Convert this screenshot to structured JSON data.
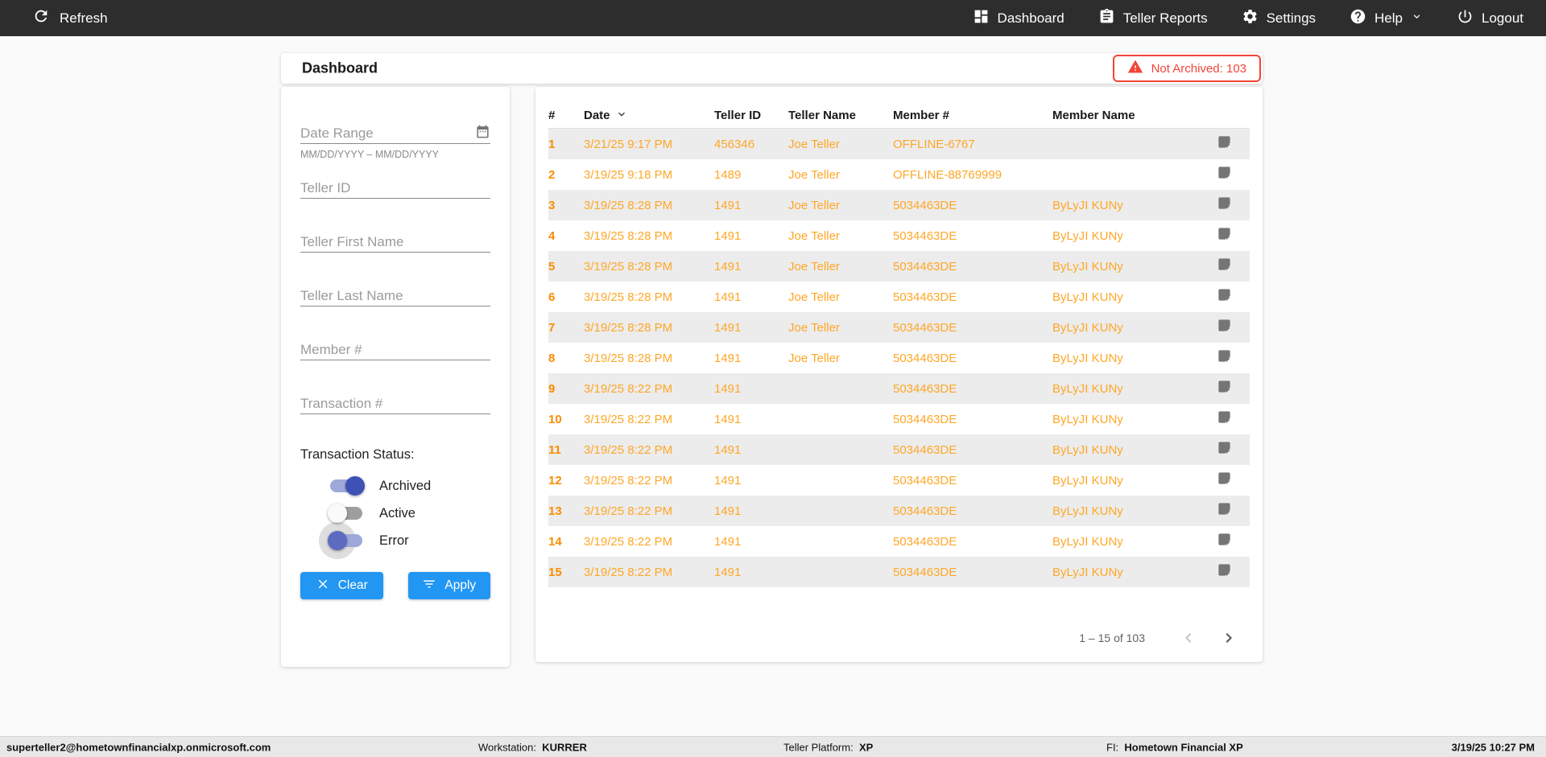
{
  "colors": {
    "topbar_bg": "#2d2d2d",
    "accent_blue": "#2196f3",
    "row_orange": "#ffa726",
    "index_orange": "#fb8c00",
    "alert_red": "#f44336",
    "toggle_indigo": "#3f51b5",
    "toggle_track_indigo": "#9fa8da"
  },
  "topbar": {
    "refresh_label": "Refresh",
    "nav_items": [
      {
        "id": "dashboard",
        "label": "Dashboard",
        "icon": "dashboard-icon"
      },
      {
        "id": "teller-reports",
        "label": "Teller Reports",
        "icon": "clipboard-icon"
      },
      {
        "id": "settings",
        "label": "Settings",
        "icon": "gear-icon"
      },
      {
        "id": "help",
        "label": "Help",
        "icon": "help-icon",
        "has_chevron": true
      },
      {
        "id": "logout",
        "label": "Logout",
        "icon": "power-icon"
      }
    ]
  },
  "header": {
    "title": "Dashboard",
    "alert_badge": "Not Archived: 103"
  },
  "filters": {
    "fields": [
      {
        "id": "date-range",
        "placeholder": "Date Range",
        "hint": "MM/DD/YYYY – MM/DD/YYYY",
        "icon": "calendar-icon"
      },
      {
        "id": "teller-id",
        "placeholder": "Teller ID"
      },
      {
        "id": "teller-first-name",
        "placeholder": "Teller First Name"
      },
      {
        "id": "teller-last-name",
        "placeholder": "Teller Last Name"
      },
      {
        "id": "member-number",
        "placeholder": "Member #"
      },
      {
        "id": "transaction-number",
        "placeholder": "Transaction #"
      }
    ],
    "status_label": "Transaction Status:",
    "toggles": [
      {
        "id": "archived",
        "label": "Archived",
        "state": "on"
      },
      {
        "id": "active",
        "label": "Active",
        "state": "off"
      },
      {
        "id": "error",
        "label": "Error",
        "state": "focus"
      }
    ],
    "clear_label": "Clear",
    "apply_label": "Apply"
  },
  "table": {
    "columns": [
      "#",
      "Date",
      "Teller ID",
      "Teller Name",
      "Member #",
      "Member Name"
    ],
    "sort_column": "Date",
    "rows": [
      {
        "num": "1",
        "date": "3/21/25 9:17 PM",
        "teller_id": "456346",
        "teller_name": "Joe Teller",
        "member_number": "OFFLINE-6767",
        "member_name": ""
      },
      {
        "num": "2",
        "date": "3/19/25 9:18 PM",
        "teller_id": "1489",
        "teller_name": "Joe Teller",
        "member_number": "OFFLINE-88769999",
        "member_name": ""
      },
      {
        "num": "3",
        "date": "3/19/25 8:28 PM",
        "teller_id": "1491",
        "teller_name": "Joe Teller",
        "member_number": "5034463DE",
        "member_name": "ByLyJI KUNy"
      },
      {
        "num": "4",
        "date": "3/19/25 8:28 PM",
        "teller_id": "1491",
        "teller_name": "Joe Teller",
        "member_number": "5034463DE",
        "member_name": "ByLyJI KUNy"
      },
      {
        "num": "5",
        "date": "3/19/25 8:28 PM",
        "teller_id": "1491",
        "teller_name": "Joe Teller",
        "member_number": "5034463DE",
        "member_name": "ByLyJI KUNy"
      },
      {
        "num": "6",
        "date": "3/19/25 8:28 PM",
        "teller_id": "1491",
        "teller_name": "Joe Teller",
        "member_number": "5034463DE",
        "member_name": "ByLyJI KUNy"
      },
      {
        "num": "7",
        "date": "3/19/25 8:28 PM",
        "teller_id": "1491",
        "teller_name": "Joe Teller",
        "member_number": "5034463DE",
        "member_name": "ByLyJI KUNy"
      },
      {
        "num": "8",
        "date": "3/19/25 8:28 PM",
        "teller_id": "1491",
        "teller_name": "Joe Teller",
        "member_number": "5034463DE",
        "member_name": "ByLyJI KUNy"
      },
      {
        "num": "9",
        "date": "3/19/25 8:22 PM",
        "teller_id": "1491",
        "teller_name": "",
        "member_number": "5034463DE",
        "member_name": "ByLyJI KUNy"
      },
      {
        "num": "10",
        "date": "3/19/25 8:22 PM",
        "teller_id": "1491",
        "teller_name": "",
        "member_number": "5034463DE",
        "member_name": "ByLyJI KUNy"
      },
      {
        "num": "11",
        "date": "3/19/25 8:22 PM",
        "teller_id": "1491",
        "teller_name": "",
        "member_number": "5034463DE",
        "member_name": "ByLyJI KUNy"
      },
      {
        "num": "12",
        "date": "3/19/25 8:22 PM",
        "teller_id": "1491",
        "teller_name": "",
        "member_number": "5034463DE",
        "member_name": "ByLyJI KUNy"
      },
      {
        "num": "13",
        "date": "3/19/25 8:22 PM",
        "teller_id": "1491",
        "teller_name": "",
        "member_number": "5034463DE",
        "member_name": "ByLyJI KUNy"
      },
      {
        "num": "14",
        "date": "3/19/25 8:22 PM",
        "teller_id": "1491",
        "teller_name": "",
        "member_number": "5034463DE",
        "member_name": "ByLyJI KUNy"
      },
      {
        "num": "15",
        "date": "3/19/25 8:22 PM",
        "teller_id": "1491",
        "teller_name": "",
        "member_number": "5034463DE",
        "member_name": "ByLyJI KUNy"
      }
    ],
    "pagination": {
      "range_text": "1 – 15 of 103"
    }
  },
  "footer": {
    "user_email": "superteller2@hometownfinancialxp.onmicrosoft.com",
    "workstation_label": "Workstation:",
    "workstation_value": "KURRER",
    "platform_label": "Teller Platform:",
    "platform_value": "XP",
    "fi_label": "FI:",
    "fi_value": "Hometown Financial XP",
    "timestamp": "3/19/25 10:27 PM"
  }
}
